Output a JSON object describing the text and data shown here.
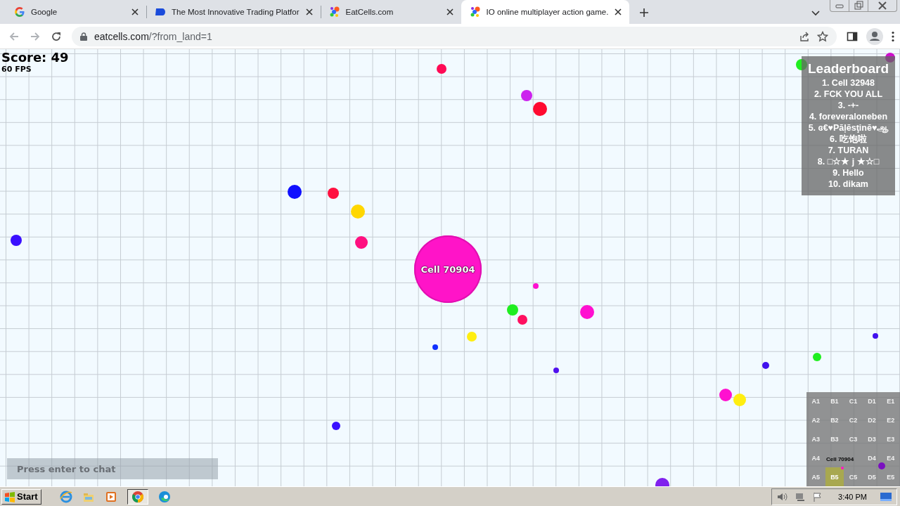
{
  "browser": {
    "tabs": [
      {
        "kind": "google",
        "title": "Google",
        "selected": false
      },
      {
        "kind": "trading",
        "title": "The Most Innovative Trading Platfor",
        "selected": false
      },
      {
        "kind": "eatcells",
        "title": "EatCells.com",
        "selected": false
      },
      {
        "kind": "eatcells",
        "title": "IO online multiplayer action game.",
        "selected": true
      }
    ],
    "address": {
      "host": "eatcells.com",
      "path": "/?from_land=1"
    }
  },
  "game": {
    "score": "Score: 49",
    "fps": "60 FPS",
    "player": {
      "name": "Cell 70904"
    },
    "leaderboard": {
      "title": "Leaderboard",
      "entries": [
        "1. Cell 32948",
        "2. FCK YOU ALL",
        "3. -+-",
        "4. foreveraloneben",
        "5. ɞ€♥Pāļēsţinē♥ஆ",
        "6. 吃饱啦",
        "7. TURAN",
        "8. □☆★ j ★☆□",
        "9. Hello",
        "10. dikam"
      ]
    },
    "chat": {
      "placeholder": "Press enter to chat"
    },
    "minimap": {
      "cells": [
        {
          "label": "A1",
          "selected": false
        },
        {
          "label": "B1",
          "selected": false
        },
        {
          "label": "C1",
          "selected": false
        },
        {
          "label": "D1",
          "selected": false
        },
        {
          "label": "E1",
          "selected": false
        },
        {
          "label": "A2",
          "selected": false
        },
        {
          "label": "B2",
          "selected": false
        },
        {
          "label": "C2",
          "selected": false
        },
        {
          "label": "D2",
          "selected": false
        },
        {
          "label": "E2",
          "selected": false
        },
        {
          "label": "A3",
          "selected": false
        },
        {
          "label": "B3",
          "selected": false
        },
        {
          "label": "C3",
          "selected": false
        },
        {
          "label": "D3",
          "selected": false
        },
        {
          "label": "E3",
          "selected": false
        },
        {
          "label": "A4",
          "selected": false
        },
        {
          "selected": false
        },
        {
          "selected": false
        },
        {
          "label": "D4",
          "selected": false
        },
        {
          "label": "E4",
          "selected": false
        },
        {
          "label": "A5",
          "selected": false
        },
        {
          "label": "B5",
          "selected": true
        },
        {
          "label": "C5",
          "selected": false
        },
        {
          "label": "D5",
          "selected": false
        },
        {
          "label": "E5",
          "selected": false
        }
      ],
      "player_label": "Cell 70904"
    }
  },
  "taskbar": {
    "start": "Start",
    "clock": "3:40 PM"
  }
}
